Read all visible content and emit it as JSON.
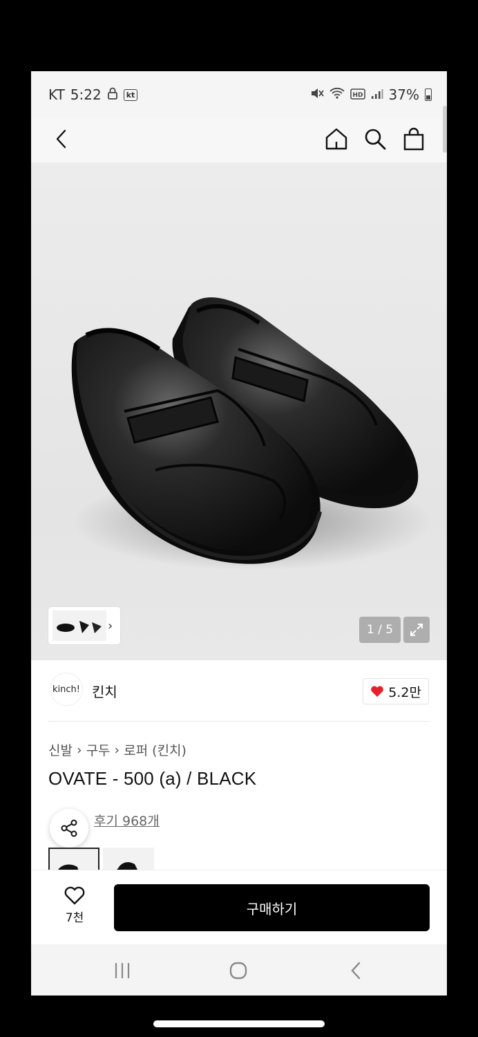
{
  "status_bar": {
    "carrier": "KT",
    "time": "5:22",
    "carrier_badge": "kt",
    "battery": "37%"
  },
  "header": {
    "back_icon": "chevron-left-icon",
    "home_icon": "home-icon",
    "search_icon": "search-icon",
    "bag_icon": "shopping-bag-icon"
  },
  "gallery": {
    "counter": "1 / 5",
    "thumb_arrow": "›"
  },
  "brand": {
    "logo_text": "kinch!",
    "name": "킨치",
    "likes": "5.2만"
  },
  "breadcrumb": [
    "신발",
    "구두",
    "로퍼 (킨치)"
  ],
  "product": {
    "title": "OVATE - 500 (a) / BLACK",
    "review_link": "후기 968개"
  },
  "actions": {
    "wish_count": "7천",
    "buy_label": "구매하기"
  },
  "colors": {
    "accent": "#e8202a",
    "buy_button": "#000000"
  }
}
